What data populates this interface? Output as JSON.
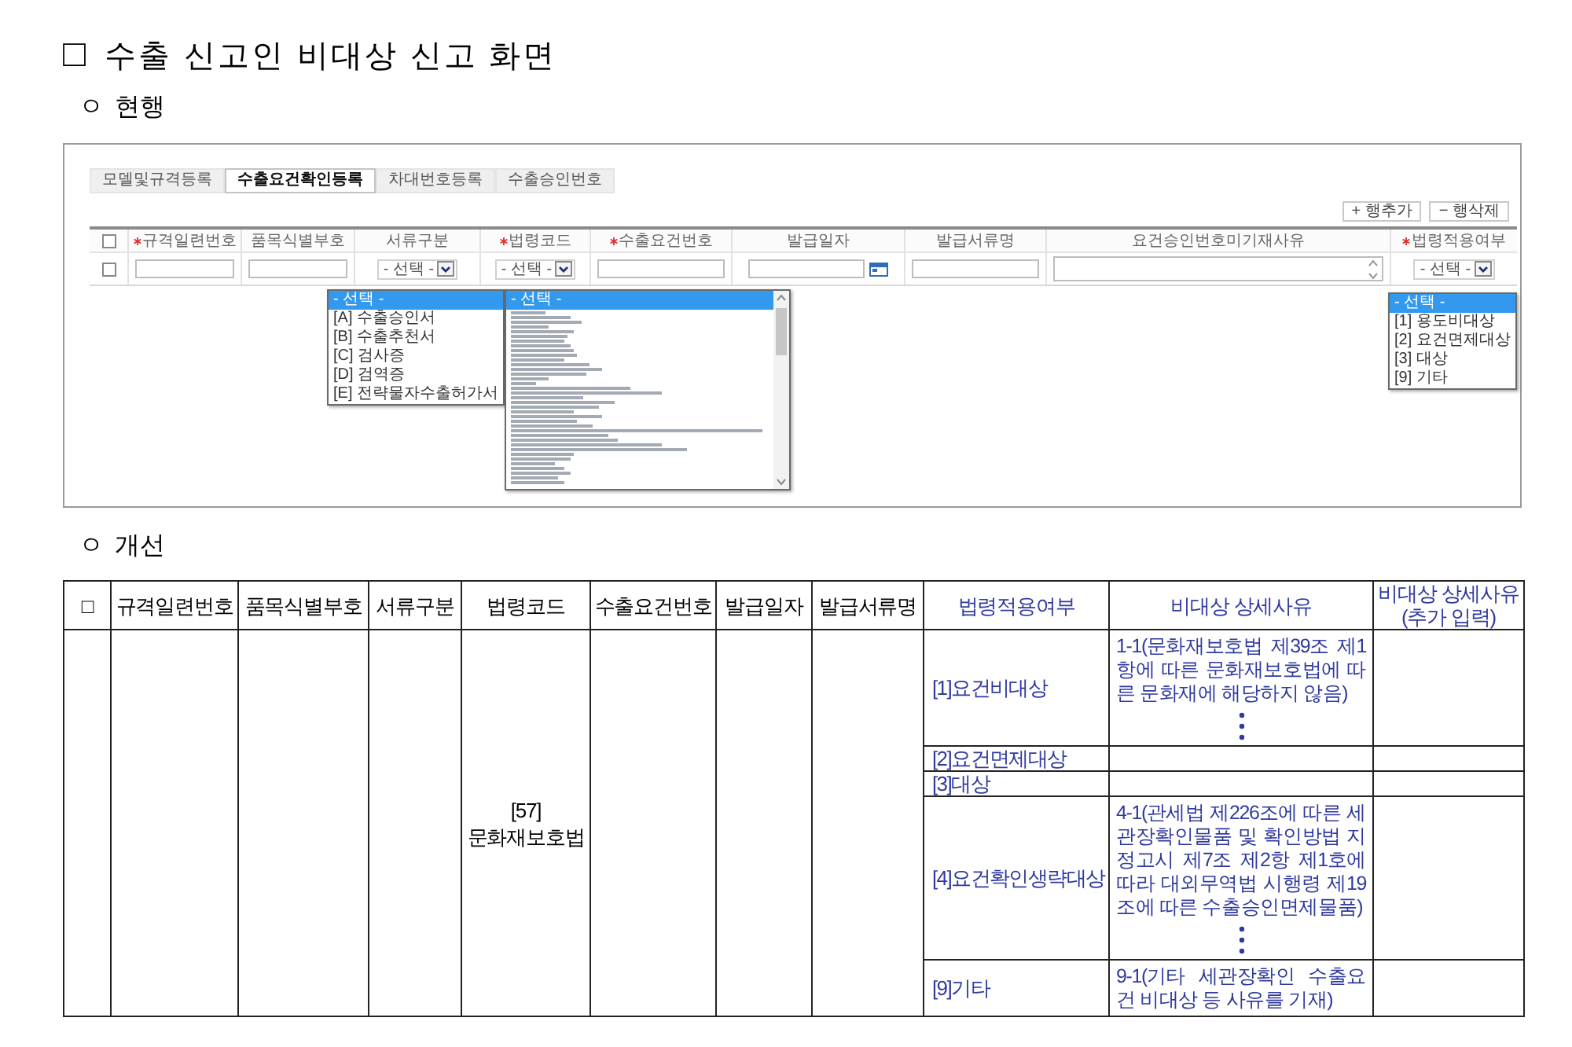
{
  "title": {
    "bullet": "□",
    "text": "수출 신고인 비대상 신고 화면"
  },
  "current": {
    "heading": {
      "bullet": "ㅇ",
      "text": "현행"
    },
    "tabs": [
      {
        "label": "모델및규격등록",
        "selected": false
      },
      {
        "label": "수출요건확인등록",
        "selected": true
      },
      {
        "label": "차대번호등록",
        "selected": false
      },
      {
        "label": "수출승인번호",
        "selected": false
      }
    ],
    "buttons": [
      {
        "label": "+ 행추가"
      },
      {
        "label": "− 행삭제"
      }
    ],
    "grid": {
      "columns": [
        {
          "kind": "checkbox",
          "checked": false
        },
        {
          "kind": "label",
          "label": "규격일련번호",
          "required": true
        },
        {
          "kind": "label",
          "label": "품목식별부호",
          "required": false
        },
        {
          "kind": "label",
          "label": "서류구분",
          "required": false
        },
        {
          "kind": "label",
          "label": "법령코드",
          "required": true
        },
        {
          "kind": "label",
          "label": "수출요건번호",
          "required": true
        },
        {
          "kind": "label",
          "label": "발급일자",
          "required": false
        },
        {
          "kind": "label",
          "label": "발급서류명",
          "required": false
        },
        {
          "kind": "label",
          "label": "요건승인번호미기재사유",
          "required": false
        },
        {
          "kind": "label",
          "label": "법령적용여부",
          "required": true
        }
      ],
      "row": [
        {
          "kind": "checkbox",
          "checked": false
        },
        {
          "kind": "input"
        },
        {
          "kind": "input"
        },
        {
          "kind": "select",
          "value": "- 선택 -"
        },
        {
          "kind": "select",
          "value": "- 선택 -"
        },
        {
          "kind": "input"
        },
        {
          "kind": "date"
        },
        {
          "kind": "input"
        },
        {
          "kind": "textarea"
        },
        {
          "kind": "select",
          "value": "- 선택 -"
        }
      ]
    },
    "open_lists": [
      {
        "kind": "document_type",
        "items": [
          {
            "label": "- 선택 -",
            "selected": true
          },
          {
            "label": "[A] 수출승인서",
            "selected": false
          },
          {
            "label": "[B] 수출추천서",
            "selected": false
          },
          {
            "label": "[C] 검사증",
            "selected": false
          },
          {
            "label": "[D] 검역증",
            "selected": false
          },
          {
            "label": "[E] 전략물자수출허가서",
            "selected": false
          }
        ]
      },
      {
        "kind": "law_code",
        "items": [
          {
            "label": "- 선택 -",
            "selected": true
          }
        ]
      },
      {
        "kind": "applicability",
        "items": [
          {
            "label": "- 선택 -",
            "selected": true
          },
          {
            "label": "[1] 용도비대상",
            "selected": false
          },
          {
            "label": "[2] 요건면제대상",
            "selected": false
          },
          {
            "label": "[3] 대상",
            "selected": false
          },
          {
            "label": "[9] 기타",
            "selected": false
          }
        ]
      }
    ]
  },
  "improved": {
    "heading": {
      "bullet": "ㅇ",
      "text": "개선"
    },
    "table": {
      "columns": [
        {
          "kind": "shared",
          "label": "□",
          "color": "#000000"
        },
        {
          "kind": "shared",
          "label": "규격일련번호",
          "color": "#000000"
        },
        {
          "kind": "shared",
          "label": "품목식별부호",
          "color": "#000000"
        },
        {
          "kind": "shared",
          "label": "서류구분",
          "color": "#000000"
        },
        {
          "kind": "shared",
          "label": "법령코드",
          "color": "#000000",
          "value": "[57]\n문화재보호법"
        },
        {
          "kind": "shared",
          "label": "수출요건번호",
          "color": "#000000"
        },
        {
          "kind": "shared",
          "label": "발급일자",
          "color": "#000000"
        },
        {
          "kind": "shared",
          "label": "발급서류명",
          "color": "#000000"
        },
        {
          "kind": "option",
          "label": "법령적용여부",
          "color": "#2f3a9e"
        },
        {
          "kind": "reason",
          "label": "비대상 상세사유",
          "color": "#2f3a9e"
        },
        {
          "kind": "extra",
          "label": "비대상 상세사유\n(추가 입력)",
          "color": "#2f3a9e"
        }
      ],
      "rows": [
        {
          "option": "[1]요건비대상",
          "reason": "1-1(문화재보호법 제39조 제1항에 따른 문화재보호법에 따른 문화재에 해당하지 않음)",
          "continued": true
        },
        {
          "option": "[2]요건면제대상",
          "continued": false
        },
        {
          "option": "[3]대상",
          "continued": false
        },
        {
          "option": "[4]요건확인생략대상",
          "reason": "4-1(관세법 제226조에 따른 세관장확인물품 및 확인방법 지정고시 제7조 제2항 제1호에 따라 대외무역법 시행령 제19조에 따른 수출승인면제물품)",
          "continued": true
        },
        {
          "option": "[9]기타",
          "reason": "9-1(기타 세관장확인 수출요건 비대상 등 사유를 기재)",
          "continued": false
        }
      ]
    }
  }
}
